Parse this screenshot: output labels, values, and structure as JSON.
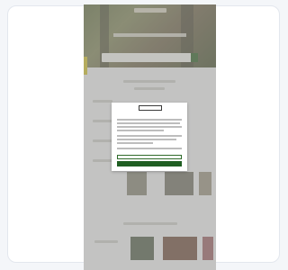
{
  "window": {
    "background": "#f4f6f9"
  },
  "website": {
    "hero_color": "#6f7a4e",
    "accent_color": "#3d6b32",
    "tab_color": "#d8c63a"
  },
  "cookie_dialog": {
    "brand_label": "",
    "title": "",
    "settings_button": "",
    "accept_button": "",
    "primary_color": "#1f5e22"
  }
}
